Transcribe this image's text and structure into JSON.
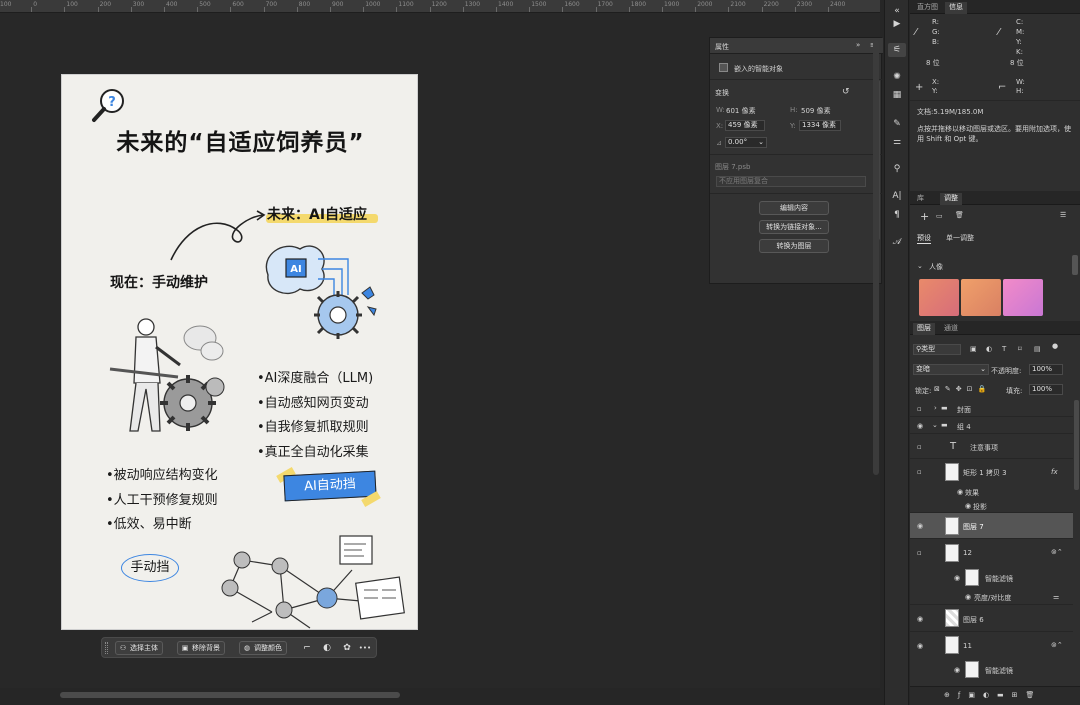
{
  "ruler": {
    "ticks": [
      "100",
      "0",
      "100",
      "200",
      "300",
      "400",
      "500",
      "600",
      "700",
      "800",
      "900",
      "1000",
      "1100",
      "1200",
      "1300",
      "1400",
      "1500",
      "1600",
      "1700",
      "1800",
      "1900",
      "2000",
      "2100",
      "2200",
      "2300",
      "2400"
    ]
  },
  "poster": {
    "title": "未来的“自适应饲养员”",
    "future_label": "未来：AI自适应",
    "now_label": "现在：手动维护",
    "ai_chip": "AI",
    "ai_bullets": [
      "•AI深度融合（LLM)",
      "•自动感知网页变动",
      "•自我修复抓取规则",
      "•真正全自动化采集"
    ],
    "manual_bullets": [
      "•被动响应结构变化",
      "•人工干预修复规则",
      "•低效、易中断"
    ],
    "auto_tag": "AI自动挡",
    "manual_tag": "手动挡"
  },
  "context_bar": {
    "select_subject": "选择主体",
    "remove_bg": "移除背景",
    "adjust_color": "调整颜色",
    "more": "•••"
  },
  "properties_panel": {
    "title": "属性",
    "object_type": "嵌入的智能对象",
    "transform_label": "变换",
    "w_label": "W:",
    "w_value": "601 像素",
    "h_label": "H:",
    "h_value": "509 像素",
    "x_label": "X:",
    "x_value": "459 像素",
    "y_label": "Y:",
    "y_value": "1334 像素",
    "angle_value": "0.00°",
    "filename": "图层 7.psb",
    "comp_placeholder": "不应用图层复合",
    "btn_edit": "编辑内容",
    "btn_convert_linked": "转换为链接对象...",
    "btn_convert_layer": "转换为图层"
  },
  "info_panel": {
    "tabs": [
      "直方图",
      "信息"
    ],
    "r": "R:",
    "g": "G:",
    "b": "B:",
    "bits_left": "8 位",
    "c": "C:",
    "m": "M:",
    "y": "Y:",
    "k": "K:",
    "bits_right": "8 位",
    "x": "X:",
    "y2": "Y:",
    "w": "W:",
    "h": "H:",
    "doc": "文档:5.19M/185.0M",
    "hint": "点按并拖移以移动图层或选区。要用附加选项，使用 Shift 和 Opt 键。"
  },
  "adjust_panel": {
    "tabs": [
      "库",
      "调整"
    ],
    "subtabs": [
      "预设",
      "单一调整"
    ],
    "section": "人像"
  },
  "layers_panel": {
    "tabs": [
      "图层",
      "通道"
    ],
    "filter": "类型",
    "blend_mode": "变暗",
    "opacity_label": "不透明度:",
    "opacity_value": "100%",
    "lock_label": "锁定:",
    "fill_label": "填充:",
    "fill_value": "100%",
    "layers": [
      {
        "name": "封面",
        "kind": "group"
      },
      {
        "name": "组 4",
        "kind": "group"
      },
      {
        "name": "注意事项",
        "kind": "text"
      },
      {
        "name": "矩形 1 拷贝 3",
        "kind": "shape",
        "fx": "fx"
      },
      {
        "name": "效果",
        "kind": "effect"
      },
      {
        "name": "投影",
        "kind": "effect"
      },
      {
        "name": "图层 7",
        "kind": "smart",
        "selected": true
      },
      {
        "name": "12",
        "kind": "smart"
      },
      {
        "name": "智能滤镜",
        "kind": "filter"
      },
      {
        "name": "亮度/对比度",
        "kind": "filter"
      },
      {
        "name": "图层 6",
        "kind": "layer"
      },
      {
        "name": "11",
        "kind": "smart"
      },
      {
        "name": "智能滤镜",
        "kind": "filter"
      }
    ]
  },
  "colors": {
    "accent_blue": "#3d86e1",
    "highlight_yellow": "#f4d96d",
    "poster_bg": "#f1f0ec"
  }
}
